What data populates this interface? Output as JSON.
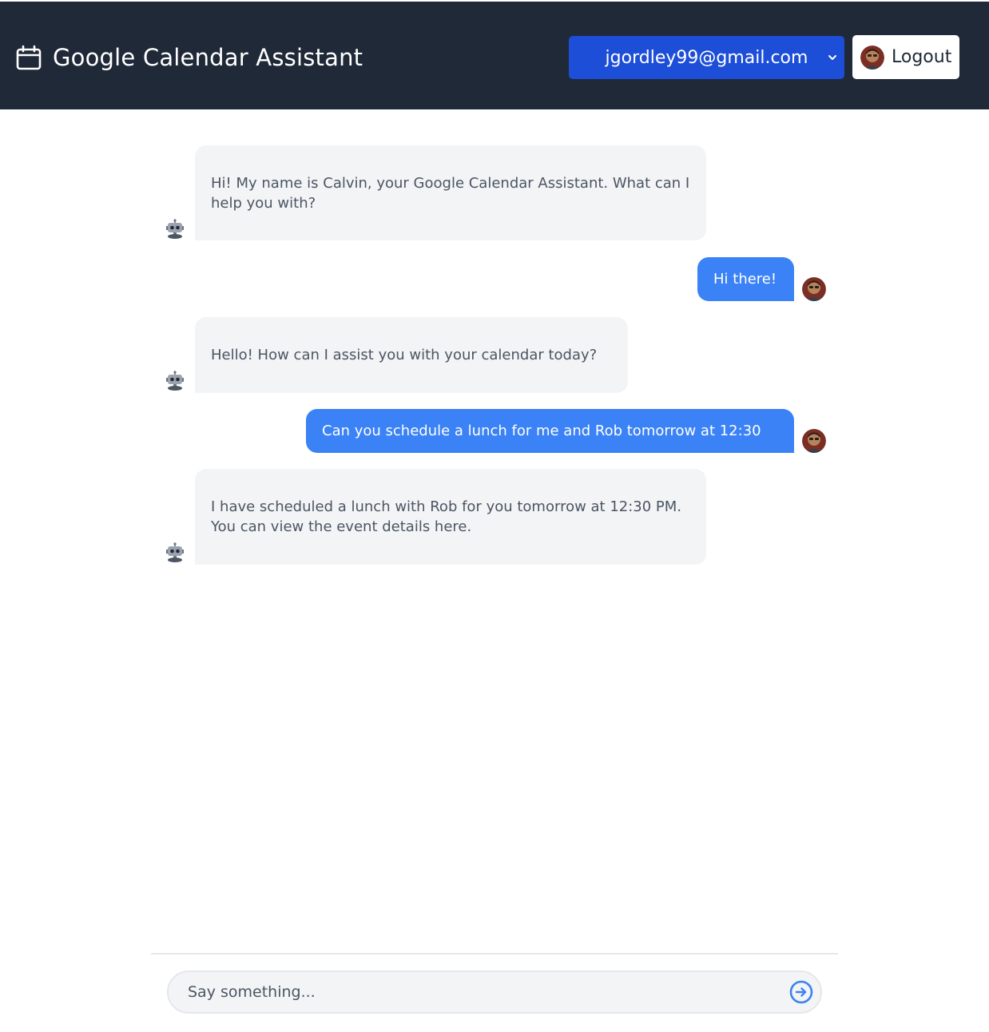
{
  "header": {
    "title": "Google Calendar Assistant",
    "account_selected": "jgordley99@gmail.com",
    "logout_label": "Logout",
    "background": "#1f2937",
    "select_color": "#1d4ed8"
  },
  "messages": [
    {
      "role": "bot",
      "text": "Hi! My name is Calvin, your Google Calendar Assistant. What can I help you with?"
    },
    {
      "role": "user",
      "text": "Hi there!"
    },
    {
      "role": "bot",
      "text": "Hello! How can I assist you with your calendar today?"
    },
    {
      "role": "user",
      "text": "Can you schedule a lunch for me and Rob tomorrow at 12:30"
    },
    {
      "role": "bot",
      "text": "I have scheduled a lunch with Rob for you tomorrow at 12:30 PM. You can view the event details here."
    }
  ],
  "composer": {
    "placeholder": "Say something...",
    "send_icon": "arrow-right-circle-icon"
  },
  "colors": {
    "bot_bubble": "#f3f4f6",
    "user_bubble": "#3b82f6",
    "accent": "#3b82f6"
  }
}
